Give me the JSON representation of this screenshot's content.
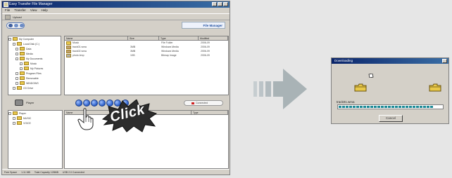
{
  "main_window": {
    "title": "Easy Transfer File Manager",
    "menu": [
      "File",
      "Transfer",
      "View",
      "Help"
    ],
    "toolbar_text": "Upload",
    "logo_text": "File Manager",
    "top_list_headers": [
      "Name",
      "Size",
      "Type",
      "Modified"
    ],
    "top_list_rows": [
      [
        "Music",
        "",
        "File Folder",
        "2006-09"
      ],
      [
        "track01.wma",
        "3MB",
        "Windows Media",
        "2006-09"
      ],
      [
        "track02.wma",
        "3MB",
        "Windows Media",
        "2006-09"
      ],
      [
        "photo.bmp",
        "1KB",
        "Bitmap Image",
        "2006-09"
      ]
    ],
    "top_tree_items": [
      "My Computer",
      "Local Disk (C:)",
      "Data",
      "Media",
      "My Documents",
      "Music",
      "My Pictures",
      "Program Files",
      "Removable",
      "WINDOWS",
      "CD Drive"
    ],
    "device_label": "Player",
    "right_pill_text": "Connected",
    "bottom_tree_items": [
      "Player",
      "MUSIC",
      "VOICE"
    ],
    "bottom_list_headers": [
      "Name",
      "Size",
      "Type"
    ],
    "status": [
      "Free Space",
      "1.11 MB",
      "Total Capacity 128MB",
      "USB 2.0 Connected"
    ]
  },
  "annotation": {
    "click_text": "Click"
  },
  "dialog": {
    "title": "Downloading",
    "file_label": "track01.wma",
    "progress_percent": 92,
    "cancel_label": "Cancel"
  },
  "colors": {
    "title_bar": "#0a246a",
    "progress": "#1c8a96",
    "burst": "#2c2c2c",
    "arrow": "#a9b3b6"
  }
}
